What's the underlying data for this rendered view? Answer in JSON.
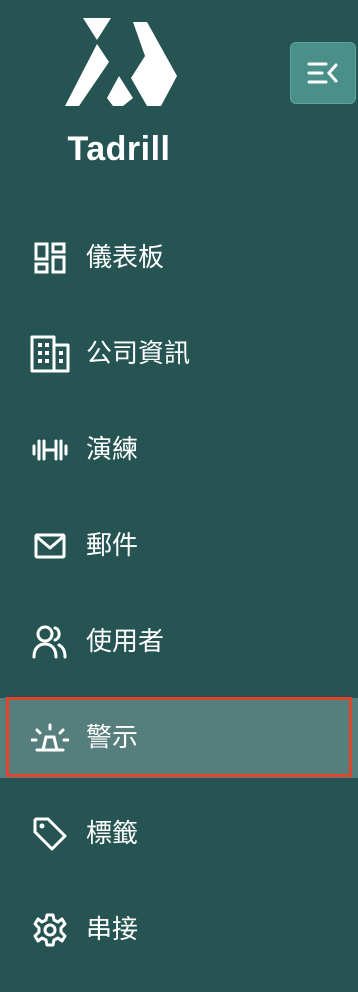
{
  "brand": {
    "name": "Tadrill",
    "logo_icon": "tadrill-logo-mark"
  },
  "toolbar": {
    "collapse_icon": "collapse-menu-icon"
  },
  "nav": {
    "items": [
      {
        "label": "儀表板",
        "icon": "dashboard-icon"
      },
      {
        "label": "公司資訊",
        "icon": "building-icon"
      },
      {
        "label": "演練",
        "icon": "dumbbell-icon"
      },
      {
        "label": "郵件",
        "icon": "mail-icon"
      },
      {
        "label": "使用者",
        "icon": "users-icon"
      },
      {
        "label": "警示",
        "icon": "alert-siren-icon",
        "active": true
      },
      {
        "label": "標籤",
        "icon": "tag-icon"
      },
      {
        "label": "串接",
        "icon": "settings-gear-icon"
      }
    ]
  },
  "colors": {
    "sidebar_bg": "#265453",
    "active_bg": "#567e7c",
    "collapse_btn_bg": "#4a8f89",
    "highlight_border": "#e0452b",
    "text": "#ffffff"
  }
}
